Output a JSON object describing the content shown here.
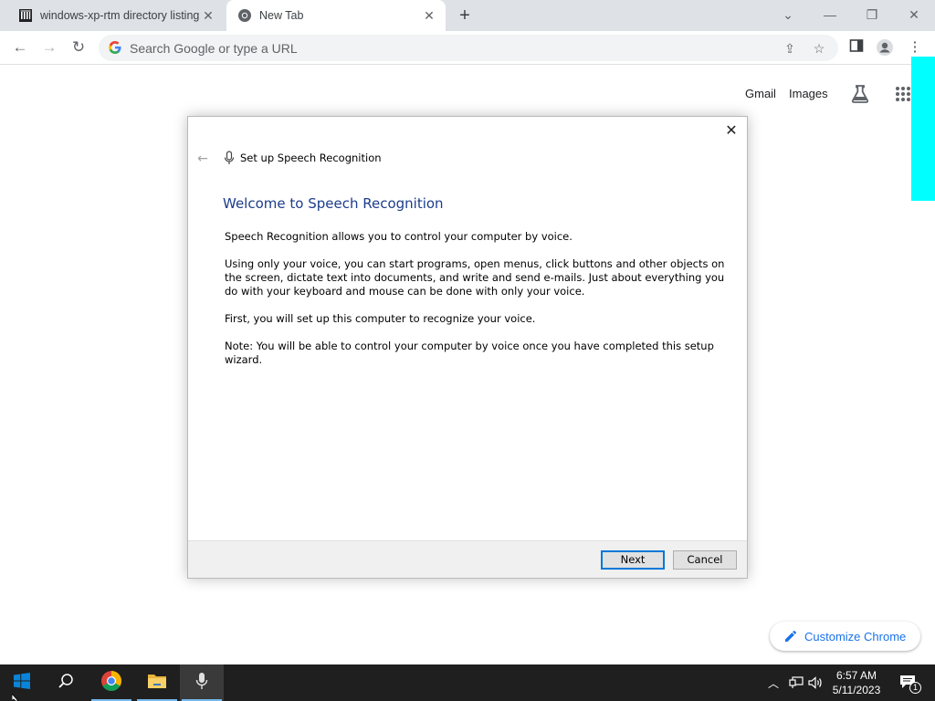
{
  "browser": {
    "tabs": [
      {
        "title": "windows-xp-rtm directory listing",
        "icon": "archive-icon"
      },
      {
        "title": "New Tab",
        "icon": "chrome-icon"
      }
    ],
    "new_tab_label": "+",
    "omnibox_placeholder": "Search Google or type a URL"
  },
  "ntp": {
    "gmail": "Gmail",
    "images": "Images",
    "customize": "Customize Chrome",
    "accent": "#00ffff"
  },
  "dialog": {
    "window_title": "Set up Speech Recognition",
    "heading": "Welcome to Speech Recognition",
    "paragraphs": [
      "Speech Recognition allows you to control your computer by voice.",
      "Using only your voice, you can start programs, open menus, click buttons and other objects on the screen, dictate text into documents, and write and send e-mails. Just about everything you do with your keyboard and mouse can be done with only your voice.",
      "First, you will set up this computer to recognize your voice.",
      "Note: You will be able to control your computer by voice once you have completed this setup wizard."
    ],
    "next_label": "Next",
    "cancel_label": "Cancel"
  },
  "taskbar": {
    "time": "6:57 AM",
    "date": "5/11/2023",
    "notification_count": "1"
  }
}
